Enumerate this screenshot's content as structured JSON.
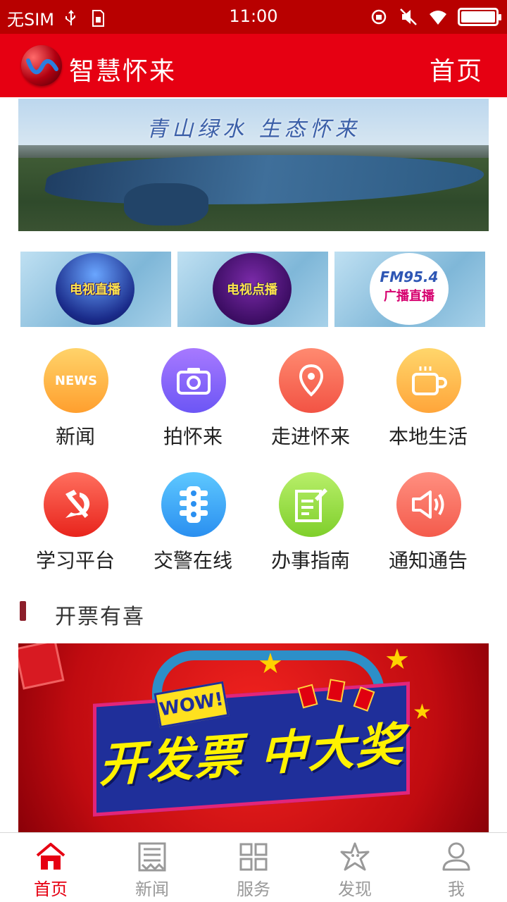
{
  "status_bar": {
    "carrier": "无SIM",
    "time": "11:00",
    "battery_level": 1.0
  },
  "header": {
    "app_name": "智慧怀来",
    "home_link": "首页"
  },
  "banner": {
    "motto": "青山绿水  生态怀来"
  },
  "live_tiles": [
    {
      "label": "电视直播",
      "icon": "tv-live-disc"
    },
    {
      "label": "电视点播",
      "icon": "tv-vod-disc"
    },
    {
      "label": "广播直播",
      "brand": "FM95.4",
      "icon": "radio-live-disc"
    }
  ],
  "grid": [
    {
      "label": "新闻",
      "icon": "news-icon",
      "icon_text": "NEWS"
    },
    {
      "label": "拍怀来",
      "icon": "camera-icon"
    },
    {
      "label": "走进怀来",
      "icon": "location-pin-icon"
    },
    {
      "label": "本地生活",
      "icon": "coffee-cup-icon"
    },
    {
      "label": "学习平台",
      "icon": "hammer-sickle-icon"
    },
    {
      "label": "交警在线",
      "icon": "traffic-light-icon"
    },
    {
      "label": "办事指南",
      "icon": "document-edit-icon"
    },
    {
      "label": "通知通告",
      "icon": "speaker-icon"
    }
  ],
  "section": {
    "title": "开票有喜"
  },
  "promo": {
    "badge": "WOW!",
    "headline": "开发票 中大奖"
  },
  "tabbar": {
    "active": "首页",
    "tabs": [
      {
        "label": "首页",
        "icon": "home-icon"
      },
      {
        "label": "新闻",
        "icon": "newspaper-icon"
      },
      {
        "label": "服务",
        "icon": "grid-icon"
      },
      {
        "label": "发现",
        "icon": "starfish-icon"
      },
      {
        "label": "我",
        "icon": "user-icon"
      }
    ]
  },
  "colors": {
    "status_bar": "#b80000",
    "header": "#e60012",
    "active_tab": "#e60012",
    "inactive_tab": "#999999"
  }
}
